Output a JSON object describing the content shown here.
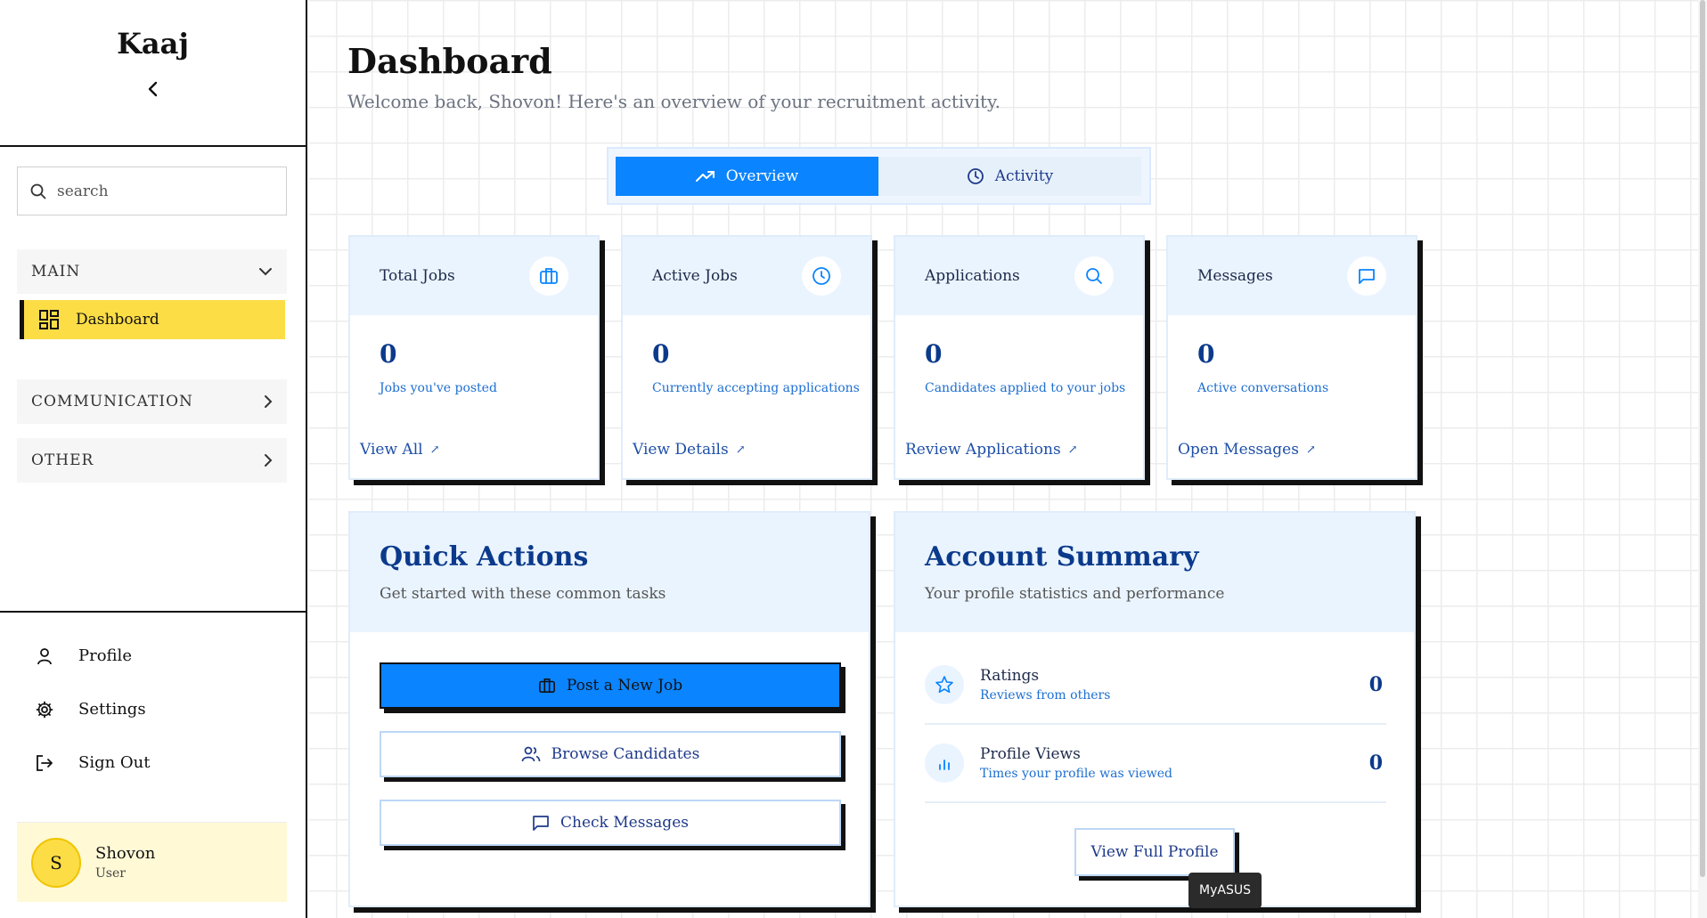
{
  "sidebar": {
    "brand": "Kaaj",
    "search_placeholder": "search",
    "sections": [
      {
        "label": "MAIN"
      },
      {
        "label": "COMMUNICATION"
      },
      {
        "label": "OTHER"
      }
    ],
    "active_item": "Dashboard",
    "bottom_items": [
      {
        "label": "Profile",
        "icon": "user-icon"
      },
      {
        "label": "Settings",
        "icon": "gear-icon"
      },
      {
        "label": "Sign Out",
        "icon": "logout-icon"
      }
    ],
    "user": {
      "initial": "S",
      "name": "Shovon",
      "role": "User"
    }
  },
  "main": {
    "title": "Dashboard",
    "subtitle": "Welcome back, Shovon! Here's an overview of your recruitment activity.",
    "tabs": [
      {
        "label": "Overview",
        "icon": "trending-up-icon",
        "active": true
      },
      {
        "label": "Activity",
        "icon": "clock-icon",
        "active": false
      }
    ],
    "stats": [
      {
        "label": "Total Jobs",
        "icon": "briefcase-icon",
        "value": "0",
        "desc": "Jobs you've posted",
        "link": "View All"
      },
      {
        "label": "Active Jobs",
        "icon": "clock-icon",
        "value": "0",
        "desc": "Currently accepting applications",
        "link": "View Details"
      },
      {
        "label": "Applications",
        "icon": "search-icon",
        "value": "0",
        "desc": "Candidates applied to your jobs",
        "link": "Review Applications"
      },
      {
        "label": "Messages",
        "icon": "message-icon",
        "value": "0",
        "desc": "Active conversations",
        "link": "Open Messages"
      }
    ],
    "quick_actions": {
      "title": "Quick Actions",
      "subtitle": "Get started with these common tasks",
      "buttons": [
        {
          "label": "Post a New Job",
          "icon": "briefcase-icon"
        },
        {
          "label": "Browse Candidates",
          "icon": "users-icon"
        },
        {
          "label": "Check Messages",
          "icon": "message-icon"
        }
      ]
    },
    "account_summary": {
      "title": "Account Summary",
      "subtitle": "Your profile statistics and performance",
      "rows": [
        {
          "title": "Ratings",
          "desc": "Reviews from others",
          "value": "0",
          "icon": "star-icon"
        },
        {
          "title": "Profile Views",
          "desc": "Times your profile was viewed",
          "value": "0",
          "icon": "bar-chart-icon"
        }
      ],
      "button": "View Full Profile"
    },
    "tooltip": "MyASUS"
  },
  "colors": {
    "accent": "#0a84ff",
    "highlight": "#fcdd46",
    "navy": "#0b3a8c"
  }
}
